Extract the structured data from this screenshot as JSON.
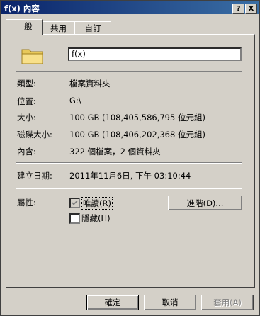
{
  "window": {
    "title": "f(x) 內容",
    "help_button": "?",
    "close_button": "X"
  },
  "tabs": [
    {
      "label": "一般",
      "active": true
    },
    {
      "label": "共用",
      "active": false
    },
    {
      "label": "自訂",
      "active": false
    }
  ],
  "general": {
    "folder_name": "f(x)",
    "icon": "folder-icon",
    "rows": [
      {
        "label": "類型:",
        "value": "檔案資料夾"
      },
      {
        "label": "位置:",
        "value": "G:\\"
      },
      {
        "label": "大小:",
        "value": "100 GB (108,405,586,795 位元組)"
      },
      {
        "label": "磁碟大小:",
        "value": "100 GB (108,406,202,368 位元組)"
      },
      {
        "label": "內含:",
        "value": "322 個檔案，2 個資料夾"
      },
      {
        "label": "建立日期:",
        "value": "2011年11月6日, 下午 03:10:44"
      }
    ],
    "attributes_label": "屬性:",
    "readonly_label": "唯讀(R)",
    "readonly_checked": true,
    "hidden_label": "隱藏(H)",
    "hidden_checked": false,
    "advanced_button": "進階(D)..."
  },
  "buttons": {
    "ok": "確定",
    "cancel": "取消",
    "apply": "套用(A)"
  }
}
